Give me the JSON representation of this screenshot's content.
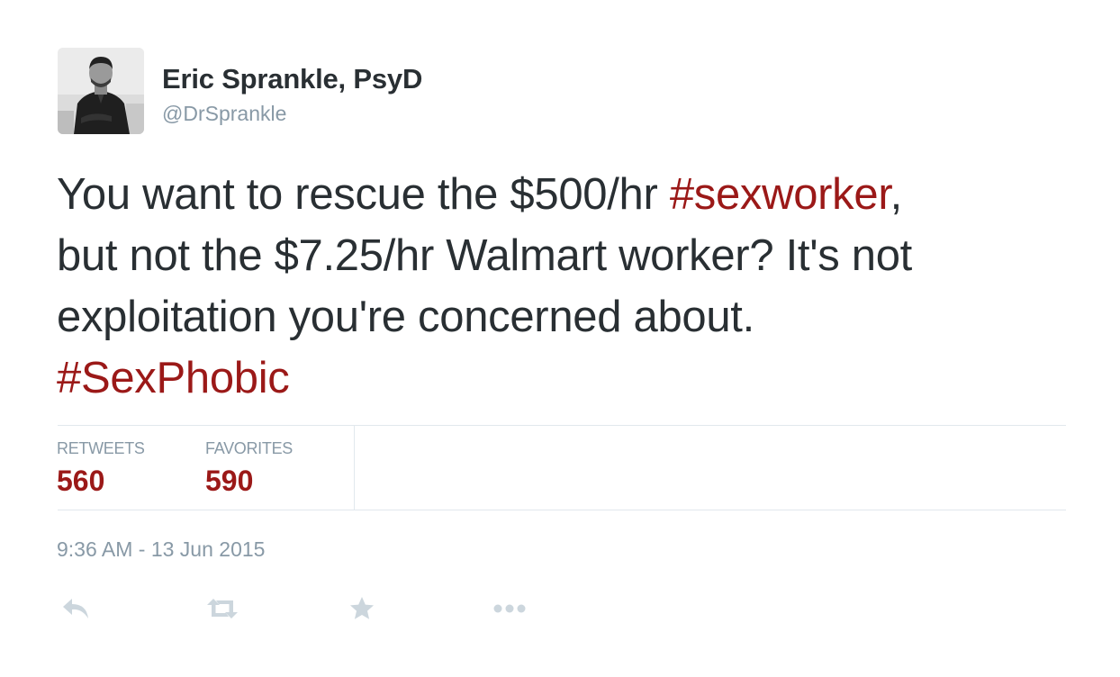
{
  "author": {
    "fullname": "Eric Sprankle, PsyD",
    "handle": "@DrSprankle",
    "avatar_icon": "profile-photo"
  },
  "tweet": {
    "line1": {
      "text_before": "You want to rescue the $500/hr ",
      "hashtag": "#sexworker",
      "text_after": ","
    },
    "line2": "but not the $7.25/hr Walmart worker? It's not",
    "line3": "exploitation you're concerned about.",
    "line4_hashtag": "#SexPhobic"
  },
  "stats": {
    "retweets_label": "RETWEETS",
    "retweets_count": "560",
    "favorites_label": "FAVORITES",
    "favorites_count": "590"
  },
  "timestamp": "9:36 AM - 13 Jun 2015",
  "actions": [
    {
      "name": "reply",
      "icon": "reply-icon"
    },
    {
      "name": "retweet",
      "icon": "retweet-icon"
    },
    {
      "name": "favorite",
      "icon": "star-icon"
    },
    {
      "name": "more",
      "icon": "more-dots-icon"
    }
  ],
  "colors": {
    "hashtag": "#9b1918",
    "text": "#292f33",
    "muted": "#8899a6",
    "divider": "#e1e8ed",
    "icon": "#ccd6dd"
  }
}
